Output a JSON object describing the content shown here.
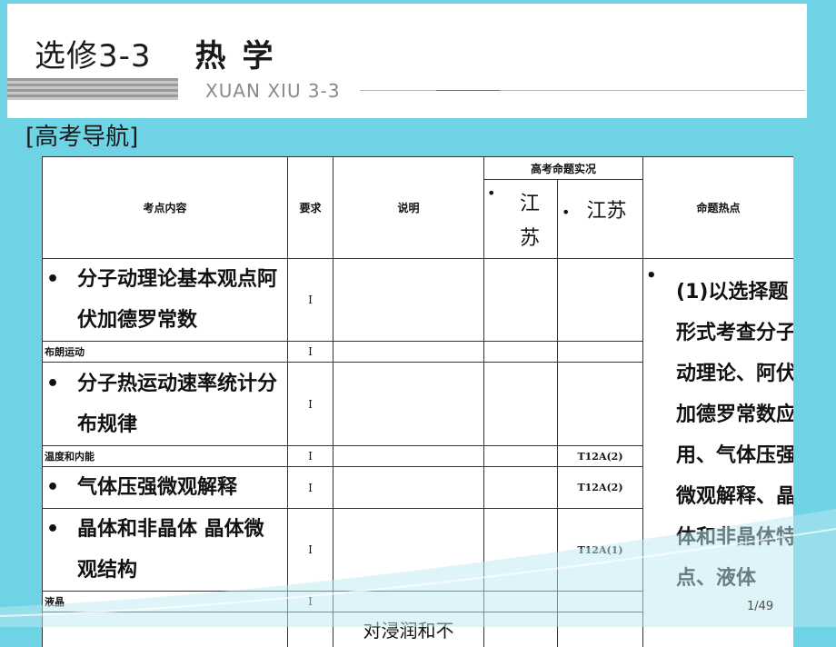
{
  "header": {
    "title_main": "选修3-3",
    "title_sub": "热学",
    "pinyin": "XUAN XIU 3-3"
  },
  "nav_label": "[高考导航]",
  "table": {
    "headers": {
      "content": "考点内容",
      "requirement": "要求",
      "note": "说明",
      "exam_group": "高考命题实况",
      "jiangsu_1": "江苏",
      "jiangsu_2": "江苏",
      "hotspot": "命题热点"
    },
    "rows": [
      {
        "content": "分子动理论基本观点阿伏加德罗常数",
        "req": "I",
        "code": ""
      },
      {
        "content": "布朗运动",
        "req": "I",
        "code": ""
      },
      {
        "content": "分子热运动速率统计分布规律",
        "req": "I",
        "code": ""
      },
      {
        "content": "温度和内能",
        "req": "I",
        "code": "T12A(2)"
      },
      {
        "content": "气体压强微观解释",
        "req": "I",
        "code": "T12A(2)"
      },
      {
        "content": "晶体和非晶体  晶体微观结构",
        "req": "I",
        "code": "T12A(1)"
      },
      {
        "content": "液晶",
        "req": "I",
        "code": ""
      },
      {
        "content": "",
        "req": "",
        "note": "对浸润和不"
      }
    ],
    "hotspot_text": "(1)以选择题形式考查分子动理论、阿伏加德罗常数应用、气体压强微观解释、晶体和非晶体特点、液体"
  },
  "page_number": "1/49"
}
